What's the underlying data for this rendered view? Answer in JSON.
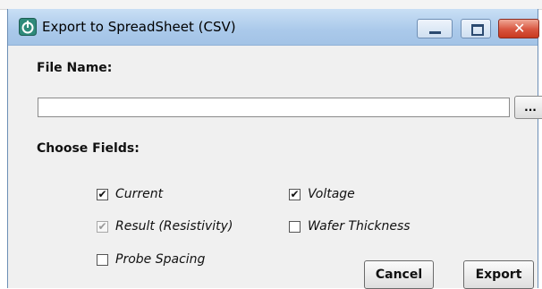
{
  "window": {
    "title": "Export to SpreadSheet (CSV)",
    "close_glyph": "✕",
    "icon": "power-icon"
  },
  "form": {
    "file_name_label": "File Name:",
    "file_name_value": "",
    "browse_label": "...",
    "choose_fields_label": "Choose Fields:"
  },
  "fields": {
    "current": {
      "label": "Current",
      "checked": true,
      "mark": "✔"
    },
    "voltage": {
      "label": "Voltage",
      "checked": true,
      "mark": "✔"
    },
    "result": {
      "label": "Result (Resistivity)",
      "checked": true,
      "disabled": true,
      "mark": "✔"
    },
    "wafer_thickness": {
      "label": "Wafer Thickness",
      "checked": false,
      "mark": ""
    },
    "probe_spacing": {
      "label": "Probe Spacing",
      "checked": false,
      "mark": ""
    }
  },
  "buttons": {
    "cancel": "Cancel",
    "export": "Export"
  },
  "colors": {
    "titlebar": "#aac9ea",
    "close_button": "#c7391f",
    "dialog_bg": "#f0f0f0"
  }
}
